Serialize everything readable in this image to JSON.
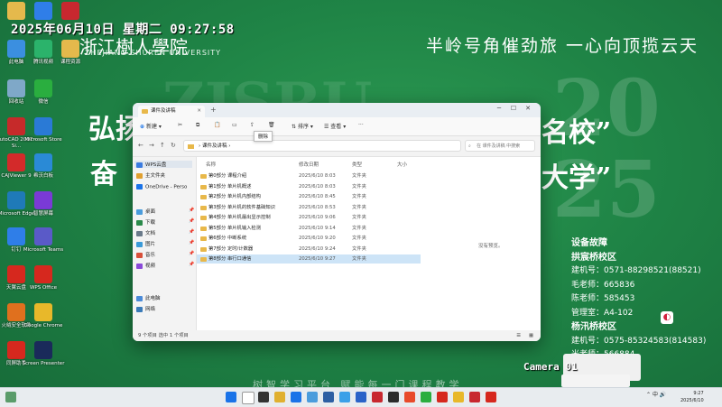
{
  "wallpaper": {
    "datetime": "2025年06月10日 星期二 09:27:58",
    "university_cn": "浙江樹人學院",
    "university_en": "ZHEJIANG SHUREN UNIVERSITY",
    "motto_top": "半岭号角催劲旅 一心向顶揽云天",
    "slogan_line1": "弘扬",
    "slogan_line1_end": "名校”",
    "slogan_line2": "奋",
    "slogan_line2_end": "大学”",
    "motto_bottom": "树智学习平台  赋能每一门课程教学",
    "big_letters": "ZJSRU",
    "big_year_top": "20",
    "big_year_bottom": "25",
    "fault_panel": {
      "title": "设备故障",
      "campus1": "拱宸桥校区",
      "line1": "建机号：0571-88298521(88521)",
      "line2": "毛老师：665836",
      "line3": "陈老师：585453",
      "line4": "管理室：A4-102",
      "campus2": "杨汛桥校区",
      "line5": "建机号：0575-85324583(814583)",
      "line6": "米老师：566884"
    }
  },
  "desktop_icons": [
    {
      "label": "",
      "color": "#e5b94c"
    },
    {
      "label": "",
      "color": "#2f7ee8"
    },
    {
      "label": "",
      "color": "#c8282f"
    },
    {
      "label": "此电脑",
      "color": "#3b8fe0"
    },
    {
      "label": "腾讯视频",
      "color": "#2bb36b"
    },
    {
      "label": "课程资源",
      "color": "#e5b94c"
    },
    {
      "label": "回收站",
      "color": "#7fa8c8"
    },
    {
      "label": "微信",
      "color": "#2aae3f"
    },
    {
      "label": "AutoCAD 2007 - Si...",
      "color": "#c62a2a"
    },
    {
      "label": "Microsoft Store",
      "color": "#2a7ad6"
    },
    {
      "label": "CAJViewer 9",
      "color": "#d32a2a"
    },
    {
      "label": "希沃白板",
      "color": "#2a8ad6"
    },
    {
      "label": "Microsoft Edge",
      "color": "#1f7ab8"
    },
    {
      "label": "智慧屏幕",
      "color": "#7a3ad6"
    },
    {
      "label": "钉钉",
      "color": "#2f7ee8"
    },
    {
      "label": "Microsoft Teams",
      "color": "#5a5ac8"
    },
    {
      "label": "天翼云盘",
      "color": "#d6281e"
    },
    {
      "label": "WPS Office",
      "color": "#d6281e"
    },
    {
      "label": "火绒安全软件",
      "color": "#e0701e"
    },
    {
      "label": "Google Chrome",
      "color": "#e8b82a"
    },
    {
      "label": "同屏助手",
      "color": "#d6281e"
    },
    {
      "label": "Screen Presenter",
      "color": "#1a2a5a"
    }
  ],
  "explorer": {
    "tab_title": "课件及讲稿",
    "new_tab": "+",
    "toolbar": {
      "new_label": "新建",
      "sort_label": "排序",
      "view_label": "查看",
      "more_label": "···",
      "tooltip": "删除"
    },
    "address": "课件及讲稿",
    "address_sep": "›",
    "search_placeholder": "在 课件及讲稿 中搜索",
    "nav": [
      {
        "label": "WPS云盘",
        "type": "cloud"
      },
      {
        "label": "主文件夹",
        "type": "home"
      },
      {
        "label": "OneDrive - Perso",
        "type": "onedrive"
      },
      {
        "label": "桌面",
        "type": "desktop"
      },
      {
        "label": "下载",
        "type": "download"
      },
      {
        "label": "文档",
        "type": "docs"
      },
      {
        "label": "图片",
        "type": "pics"
      },
      {
        "label": "音乐",
        "type": "music"
      },
      {
        "label": "视频",
        "type": "video"
      },
      {
        "label": "此电脑",
        "type": "pc"
      },
      {
        "label": "网络",
        "type": "net"
      }
    ],
    "columns": {
      "name": "名称",
      "date": "修改日期",
      "type": "类型",
      "size": "大小"
    },
    "files": [
      {
        "name": "第0部分 课程介绍",
        "date": "2025/6/10 8:03",
        "type": "文件夹"
      },
      {
        "name": "第1部分 单片机概述",
        "date": "2025/6/10 8:03",
        "type": "文件夹"
      },
      {
        "name": "第2部分 单片机内部结构",
        "date": "2025/6/10 8:45",
        "type": "文件夹"
      },
      {
        "name": "第3部分 单片机的软件基础知识",
        "date": "2025/6/10 8:53",
        "type": "文件夹"
      },
      {
        "name": "第4部分 单片机最出显示控制",
        "date": "2025/6/10 9:06",
        "type": "文件夹"
      },
      {
        "name": "第5部分 单片机输入检测",
        "date": "2025/6/10 9:14",
        "type": "文件夹"
      },
      {
        "name": "第6部分 中断系统",
        "date": "2025/6/10 9:20",
        "type": "文件夹"
      },
      {
        "name": "第7部分 定时/计数器",
        "date": "2025/6/10 9:24",
        "type": "文件夹"
      },
      {
        "name": "第8部分 串行口通信",
        "date": "2025/6/10 9:27",
        "type": "文件夹"
      }
    ],
    "preview_text": "没有预览。",
    "status": "9 个项目   选中 1 个项目"
  },
  "camera": {
    "label": "Camera 01"
  },
  "taskbar": {
    "tray_lang": "中",
    "time": "9:27",
    "date": "2025/6/10"
  }
}
